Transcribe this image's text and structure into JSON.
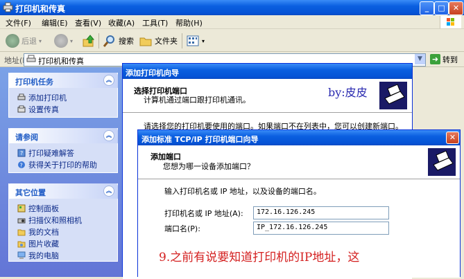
{
  "window": {
    "title": "打印机和传真"
  },
  "menu": [
    "文件(F)",
    "编辑(E)",
    "查看(V)",
    "收藏(A)",
    "工具(T)",
    "帮助(H)"
  ],
  "toolbar": {
    "back": "后退",
    "search": "搜索",
    "folders": "文件夹"
  },
  "address": {
    "label": "地址(D)",
    "value": "打印机和传真",
    "go": "转到"
  },
  "tasks": {
    "printer_tasks": {
      "title": "打印机任务",
      "items": [
        "添加打印机",
        "设置传真"
      ]
    },
    "see_also": {
      "title": "请参阅",
      "items": [
        "打印疑难解答",
        "获得关于打印的帮助"
      ]
    },
    "other_places": {
      "title": "其它位置",
      "items": [
        "控制面板",
        "扫描仪和照相机",
        "我的文档",
        "图片收藏",
        "我的电脑"
      ]
    }
  },
  "wizard1": {
    "title": "添加打印机向导",
    "heading": "选择打印机端口",
    "subheading": "计算机通过端口跟打印机通讯。",
    "watermark": "by:皮皮",
    "instruction": "请选择您的打印机要使用的端口。如果端口不在列表中，您可以创建新端口。"
  },
  "wizard2": {
    "title": "添加标准 TCP/IP 打印机端口向导",
    "heading": "添加端口",
    "subheading": "您想为哪一设备添加端口？",
    "instruction": "输入打印机名或 IP 地址，以及设备的端口名。",
    "ip_label": "打印机名或 IP 地址(A):",
    "ip_value": "172.16.126.245",
    "port_label": "端口名(P):",
    "port_value": "IP_172.16.126.245",
    "annotation": "9.之前有说要知道打印机的IP地址，这"
  },
  "colors": {
    "annotation": "#D42020",
    "watermark": "#2A2AB0",
    "titlebar": "#0A5FE0",
    "taskpane": "#7BA2E7"
  }
}
